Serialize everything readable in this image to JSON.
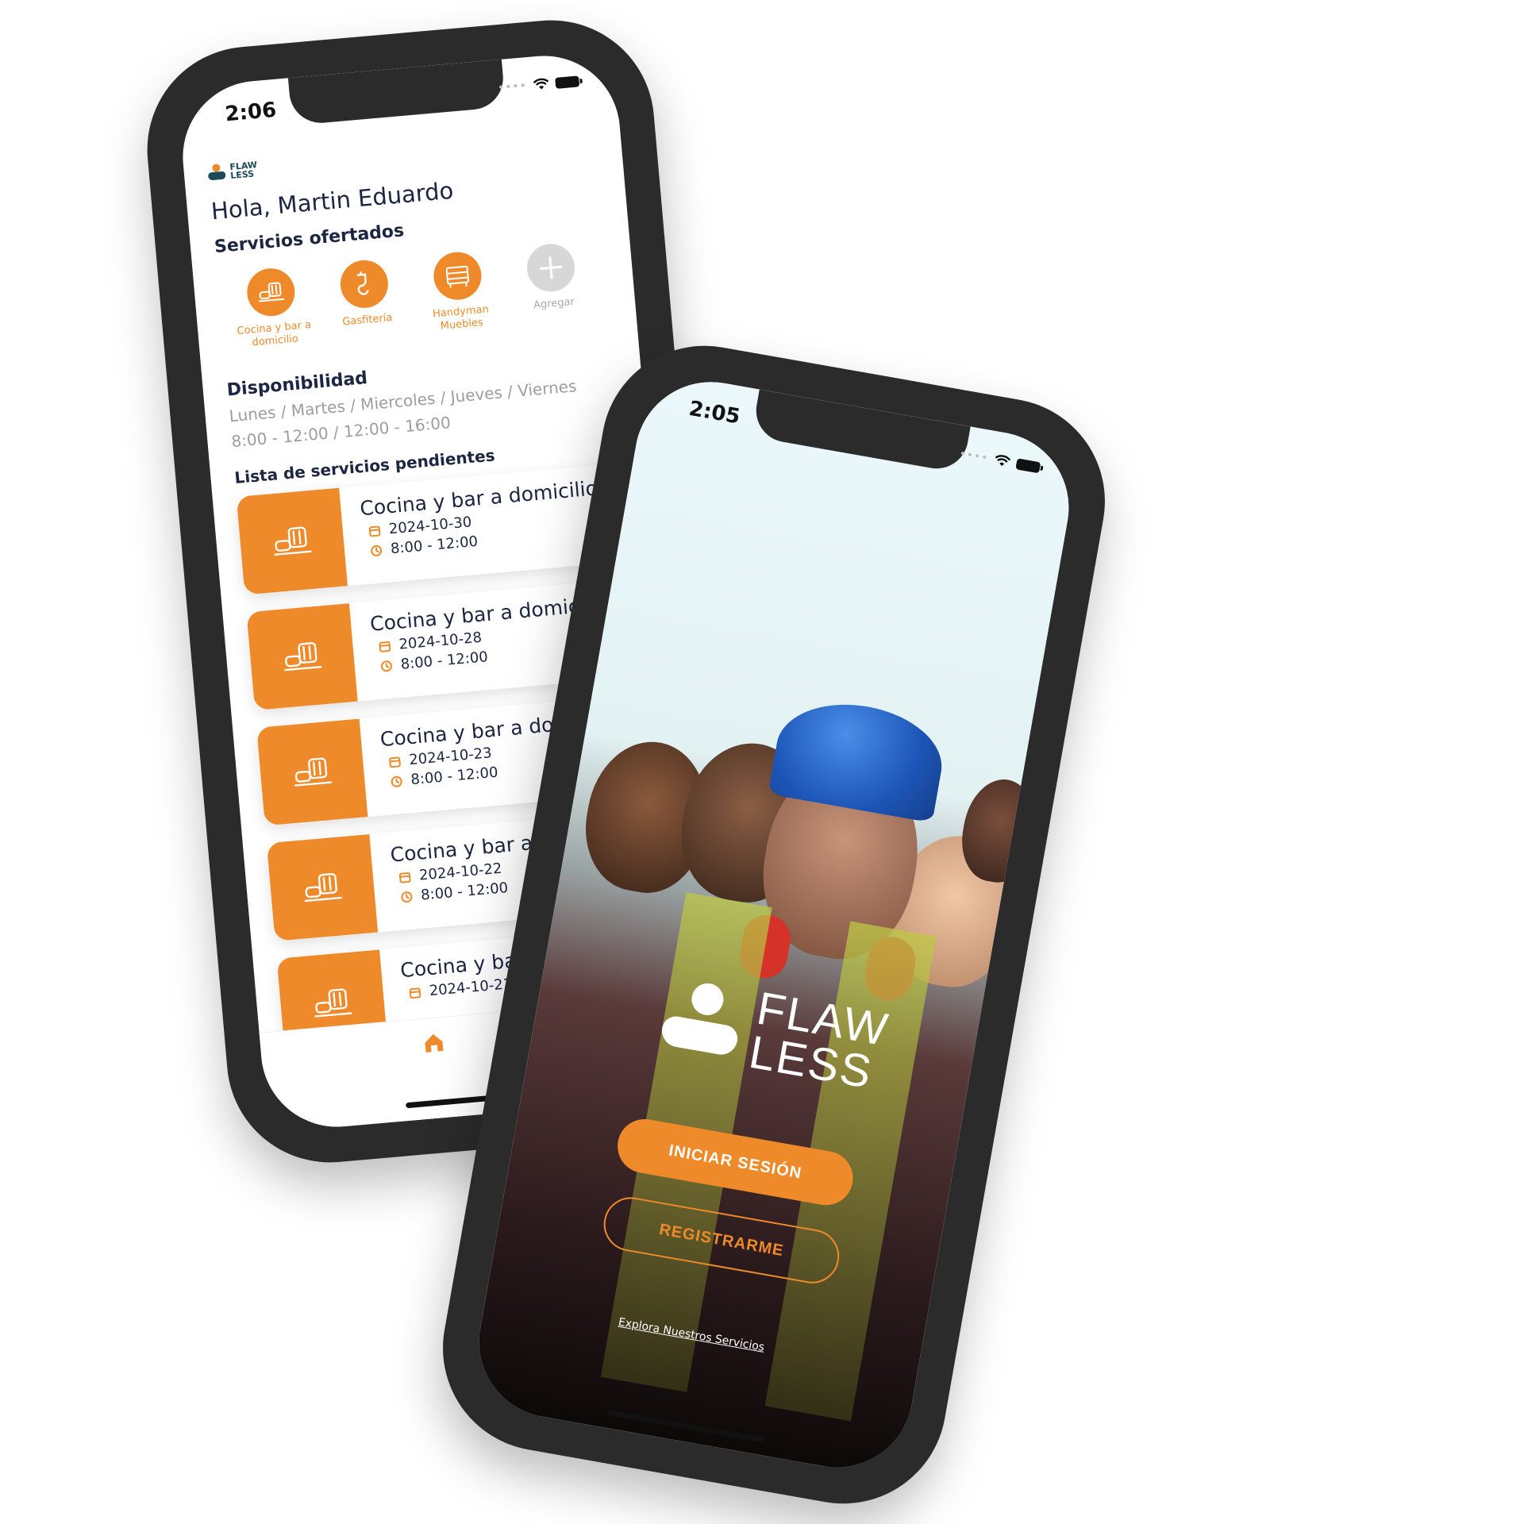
{
  "dashboard": {
    "status_time": "2:06",
    "logo_text_line1": "FLAW",
    "logo_text_line2": "LESS",
    "greeting": "Hola, Martin Eduardo",
    "services_title": "Servicios ofertados",
    "services": [
      {
        "label": "Cocina y bar a domicilio",
        "icon": "cooking-icon"
      },
      {
        "label": "Gasfitería",
        "icon": "faucet-icon"
      },
      {
        "label": "Handyman Muebles",
        "icon": "furniture-icon"
      },
      {
        "label": "Agregar",
        "icon": "plus-icon"
      }
    ],
    "availability_title": "Disponibilidad",
    "availability_days": "Lunes / Martes / Miercoles / Jueves / Viernes",
    "availability_hours": "8:00 - 12:00 / 12:00 - 16:00",
    "pending_title": "Lista de servicios pendientes",
    "pending": [
      {
        "title": "Cocina y bar a domicilio",
        "date": "2024-10-30",
        "time": "8:00 - 12:00"
      },
      {
        "title": "Cocina y bar a domicilio",
        "date": "2024-10-28",
        "time": "8:00 - 12:00"
      },
      {
        "title": "Cocina y bar a domicilio",
        "date": "2024-10-23",
        "time": "8:00 - 12:00"
      },
      {
        "title": "Cocina y bar a domicilio",
        "date": "2024-10-22",
        "time": "8:00 - 12:00"
      },
      {
        "title": "Cocina y bar a domicilio",
        "date": "2024-10-21",
        "time": ""
      }
    ],
    "tabs": [
      {
        "name": "home-icon",
        "active": true
      },
      {
        "name": "document-icon",
        "active": false
      }
    ]
  },
  "login": {
    "status_time": "2:05",
    "logo_text_line1": "FLAW",
    "logo_text_line2": "LESS",
    "login_button": "INICIAR SESIÓN",
    "register_button": "REGISTRARME",
    "explore_link": "Explora Nuestros Servicios"
  },
  "colors": {
    "accent": "#ef8a2a",
    "text_dark": "#1c2541",
    "muted": "#9d9d9d",
    "frame": "#2b2b2b"
  }
}
